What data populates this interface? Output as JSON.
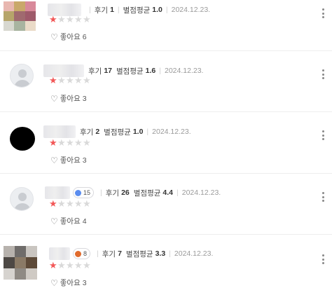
{
  "reviews": [
    {
      "avatar": "photo",
      "palette": [
        "#e8b7b0",
        "#c9a86a",
        "#d8899a",
        "#b6a56a",
        "#a06a6f",
        "#9e5a6a",
        "#d8d8d0",
        "#a8b4a0",
        "#eadbc8"
      ],
      "badge": null,
      "review_label": "후기",
      "review_count": "1",
      "rating_label": "별점평균",
      "rating_avg": "1.0",
      "date": "2024.12.23.",
      "stars": 1,
      "like_label": "좋아요",
      "like_count": "6"
    },
    {
      "avatar": "default",
      "badge": null,
      "review_label": "후기",
      "review_count": "17",
      "rating_label": "별점평균",
      "rating_avg": "1.6",
      "date": "2024.12.23.",
      "stars": 1,
      "like_label": "좋아요",
      "like_count": "3"
    },
    {
      "avatar": "black",
      "badge": null,
      "review_label": "후기",
      "review_count": "2",
      "rating_label": "별점평균",
      "rating_avg": "1.0",
      "date": "2024.12.23.",
      "stars": 1,
      "like_label": "좋아요",
      "like_count": "3"
    },
    {
      "avatar": "default",
      "badge": {
        "text": "15",
        "color": "#5b8def"
      },
      "review_label": "후기",
      "review_count": "26",
      "rating_label": "별점평균",
      "rating_avg": "4.4",
      "date": "2024.12.23.",
      "stars": 1,
      "like_label": "좋아요",
      "like_count": "4"
    },
    {
      "avatar": "photo",
      "palette": [
        "#b7b2ad",
        "#6f6c6a",
        "#c9c5c0",
        "#4d4844",
        "#8a7a66",
        "#5d4a38",
        "#d6d3cf",
        "#8f8a84",
        "#cfcac4"
      ],
      "badge": {
        "text": "8",
        "color": "#e06b2d"
      },
      "review_label": "후기",
      "review_count": "7",
      "rating_label": "별점평균",
      "rating_avg": "3.3",
      "date": "2024.12.23.",
      "stars": 1,
      "like_label": "좋아요",
      "like_count": "3"
    }
  ],
  "star_glyph": "★",
  "heart_icon": "♡",
  "max_stars": 5
}
